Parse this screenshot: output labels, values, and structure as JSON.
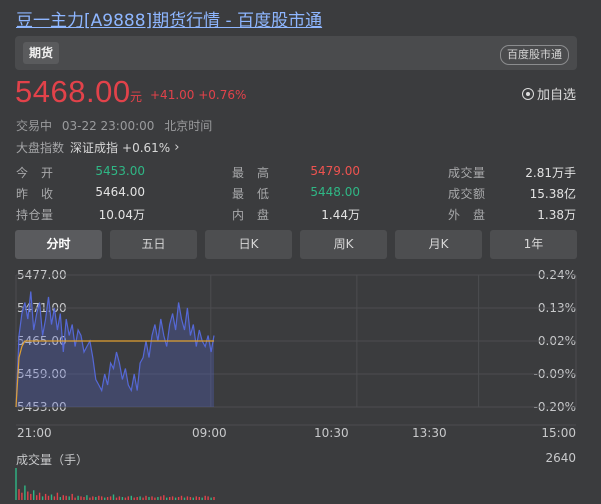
{
  "page_title": "豆一主力[A9888]期货行情 - 百度股市通",
  "tabbar": {
    "active_tab": "期货",
    "brand": "百度股市通"
  },
  "quote": {
    "price": "5468.00",
    "unit": "元",
    "change": "+41.00 +0.76%",
    "add_watch": "加自选",
    "status": "交易中",
    "time": "03-22 23:00:00",
    "timezone": "北京时间",
    "index_label": "大盘指数",
    "index_name": "深证成指",
    "index_change": "+0.61%"
  },
  "stats": {
    "open_label": "今　开",
    "open": "5453.00",
    "prev_close_label": "昨　收",
    "prev_close": "5464.00",
    "open_interest_label": "持仓量",
    "open_interest": "10.04万",
    "high_label": "最　高",
    "high": "5479.00",
    "low_label": "最　低",
    "low": "5448.00",
    "inner_label": "内　盘",
    "inner": "1.44万",
    "volume_label": "成交量",
    "volume": "2.81万手",
    "turnover_label": "成交额",
    "turnover": "15.38亿",
    "outer_label": "外　盘",
    "outer": "1.38万"
  },
  "period_tabs": [
    "分时",
    "五日",
    "日K",
    "周K",
    "月K",
    "1年"
  ],
  "active_period": "分时",
  "chart_data": {
    "type": "line",
    "price_ticks": [
      "5477.00",
      "5471.00",
      "5465.00",
      "5459.00",
      "5453.00"
    ],
    "pct_ticks": [
      "0.24%",
      "0.13%",
      "0.02%",
      "-0.09%",
      "-0.20%"
    ],
    "x_ticks": [
      "21:00",
      "09:00",
      "10:30",
      "13:30",
      "15:00"
    ],
    "ylim": [
      5453,
      5477
    ],
    "x_span_minutes": 345,
    "reference_price": 5465,
    "price_series": [
      5453,
      5466,
      5470,
      5472,
      5469,
      5474,
      5467,
      5470,
      5472,
      5466,
      5469,
      5473,
      5468,
      5471,
      5467,
      5470,
      5463,
      5469,
      5466,
      5468,
      5464,
      5467,
      5466,
      5463,
      5464,
      5465,
      5462,
      5458,
      5457,
      5456,
      5459,
      5457,
      5461,
      5460,
      5463,
      5461,
      5458,
      5460,
      5457,
      5456,
      5459,
      5456,
      5461,
      5462,
      5465,
      5462,
      5466,
      5468,
      5465,
      5469,
      5466,
      5464,
      5468,
      5470,
      5467,
      5472,
      5469,
      5467,
      5471,
      5466,
      5468,
      5464,
      5467,
      5465,
      5464,
      5466,
      5463,
      5466
    ],
    "avg_series": [
      5453,
      5462,
      5464,
      5465,
      5465,
      5465,
      5465,
      5465,
      5465,
      5465,
      5465,
      5465,
      5465,
      5465,
      5465,
      5465,
      5465,
      5465,
      5465,
      5465,
      5465,
      5465,
      5465,
      5465,
      5465,
      5465,
      5465,
      5465,
      5465,
      5465,
      5465,
      5465,
      5465,
      5465,
      5465,
      5465,
      5465,
      5465,
      5465,
      5465,
      5465,
      5465,
      5465,
      5465,
      5465,
      5465,
      5465,
      5465,
      5465,
      5465,
      5465,
      5465,
      5465,
      5465,
      5465,
      5465,
      5465,
      5465,
      5465,
      5465,
      5465,
      5465,
      5465,
      5465,
      5465,
      5465,
      5465,
      5465
    ],
    "volume_title": "成交量（手）",
    "volume_max": "2640",
    "volume_series": [
      2640,
      900,
      600,
      1200,
      700,
      500,
      800,
      400,
      600,
      300,
      500,
      350,
      450,
      300,
      600,
      250,
      400,
      350,
      300,
      500,
      200,
      350,
      300,
      250,
      400,
      200,
      300,
      250,
      350,
      300,
      200,
      250,
      300,
      450,
      200,
      300,
      250,
      200,
      300,
      350,
      200,
      250,
      300,
      200,
      350,
      250,
      300,
      200,
      250,
      300,
      400,
      200,
      250,
      300,
      200,
      250,
      350,
      200,
      300,
      250,
      200,
      300,
      250,
      200,
      350,
      300,
      200,
      250
    ]
  },
  "colors": {
    "price_up": "#e2424a",
    "price_line": "#5568d6",
    "avg_line": "#e0a030",
    "stat_green": "#2fb785",
    "stat_red": "#ef5350"
  }
}
